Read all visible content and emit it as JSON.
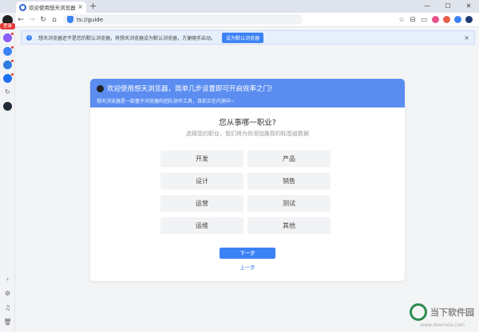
{
  "tab": {
    "title": "欢迎使用想天浏览器",
    "close": "×",
    "new_tab": "+"
  },
  "window": {
    "minimize": "—",
    "maximize": "☐",
    "close": "✕"
  },
  "toolbar": {
    "back": "←",
    "forward": "→",
    "reload": "↻",
    "home": "⌂",
    "url": "ts://guide",
    "star": "☆",
    "collections": "⊟",
    "split": "▭"
  },
  "sidebar": {
    "login": "登录",
    "expand": "›",
    "settings": "⚙",
    "bell": "♫",
    "trash": "🗑"
  },
  "notice": {
    "info": "i",
    "text": "想天浏览器还不是您的默认浏览器，将想天浏览器设为默认浏览器，方便随手启动。",
    "button": "设为默认浏览器",
    "close": "×"
  },
  "guide": {
    "title": "欢迎使用想天浏览器，简单几步设置即可开启效率之门!",
    "subtitle": "想天浏览器是一款基于浏览器的团队协作工具，目前正在内测中~",
    "question": "您从事哪一职业?",
    "hint": "选择您的职业，我们将为你添加推荐的标签组数据",
    "roles": [
      "开发",
      "产品",
      "设计",
      "销售",
      "运营",
      "测试",
      "运维",
      "其他"
    ],
    "next": "下一步",
    "prev": "上一步"
  },
  "watermark": {
    "name": "当下软件园",
    "url": "www.downxia.com"
  },
  "colors": {
    "accent": "#3b82f6",
    "header": "#5b8df0",
    "danger": "#e53935"
  }
}
